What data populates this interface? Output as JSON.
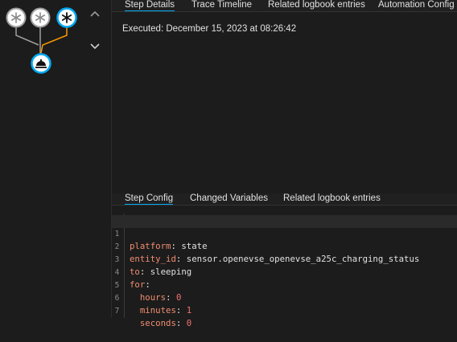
{
  "colors": {
    "accent": "#03a9f4",
    "trace_active": "#ff9800",
    "trace_inactive": "#9e9e9e",
    "yaml_key": "#f08d6f",
    "yaml_number": "#f06f6f"
  },
  "trace_graph": {
    "nodes": [
      {
        "icon": "asterisk-icon",
        "state": "inactive"
      },
      {
        "icon": "asterisk-icon",
        "state": "inactive"
      },
      {
        "icon": "asterisk-icon",
        "state": "active"
      },
      {
        "icon": "bell-icon",
        "state": "active"
      }
    ]
  },
  "nav": {
    "up_icon": "chevron-up-icon",
    "down_icon": "chevron-down-icon"
  },
  "top_tabs": {
    "step_details": "Step Details",
    "trace_timeline": "Trace Timeline",
    "related_logbook": "Related logbook entries",
    "automation_config": "Automation Config"
  },
  "details": {
    "executed": "Executed: December 15, 2023 at 08:26:42"
  },
  "bottom_tabs": {
    "step_config": "Step Config",
    "changed_variables": "Changed Variables",
    "related_logbook": "Related logbook entries"
  },
  "code": {
    "lines": [
      {
        "num": "1",
        "key": "platform",
        "value": "state"
      },
      {
        "num": "2",
        "key": "entity_id",
        "value": "sensor.openevse_openevse_a25c_charging_status"
      },
      {
        "num": "3",
        "key": "to",
        "value": "sleeping"
      },
      {
        "num": "4",
        "key": "for",
        "value": ""
      },
      {
        "num": "5",
        "key": "hours",
        "value": "0"
      },
      {
        "num": "6",
        "key": "minutes",
        "value": "1"
      },
      {
        "num": "7",
        "key": "seconds",
        "value": "0"
      }
    ]
  }
}
